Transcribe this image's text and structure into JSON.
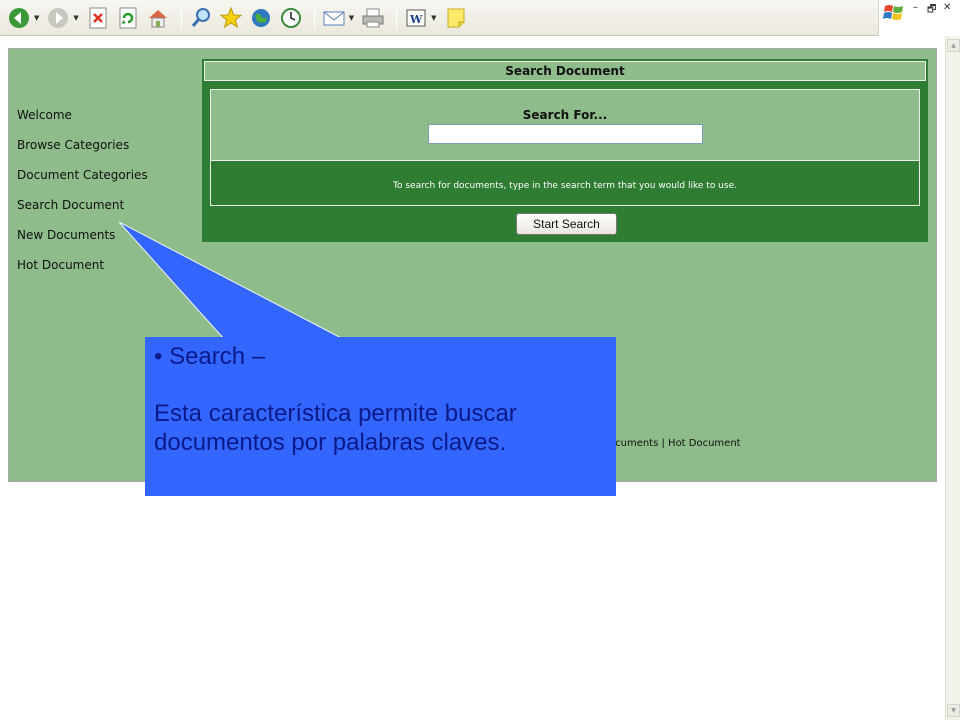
{
  "browser": {
    "toolbar_icons": [
      "back-icon",
      "forward-icon",
      "stop-icon",
      "refresh-icon",
      "home-icon",
      "search-icon",
      "favorites-icon",
      "media-icon",
      "history-icon",
      "mail-icon",
      "print-icon",
      "word-icon",
      "note-icon"
    ],
    "window_controls": [
      "–",
      "🗗",
      "✕"
    ]
  },
  "sidebar": {
    "items": [
      {
        "label": "Welcome"
      },
      {
        "label": "Browse Categories"
      },
      {
        "label": "Document Categories"
      },
      {
        "label": "Search Document"
      },
      {
        "label": "New Documents"
      },
      {
        "label": "Hot Document"
      }
    ]
  },
  "search_panel": {
    "title": "Search Document",
    "field_label": "Search For...",
    "input_value": "",
    "hint": "To search for documents, type in the search term that you would like to use.",
    "button_label": "Start Search"
  },
  "footer": {
    "links_text": "ocuments | Hot Document"
  },
  "callout": {
    "heading": "• Search –",
    "body": "Esta característica permite buscar documentos por palabras claves.",
    "color": "#3366ff"
  },
  "colors": {
    "page_bg": "#8fbc8b",
    "panel_green": "#2e7d32"
  }
}
